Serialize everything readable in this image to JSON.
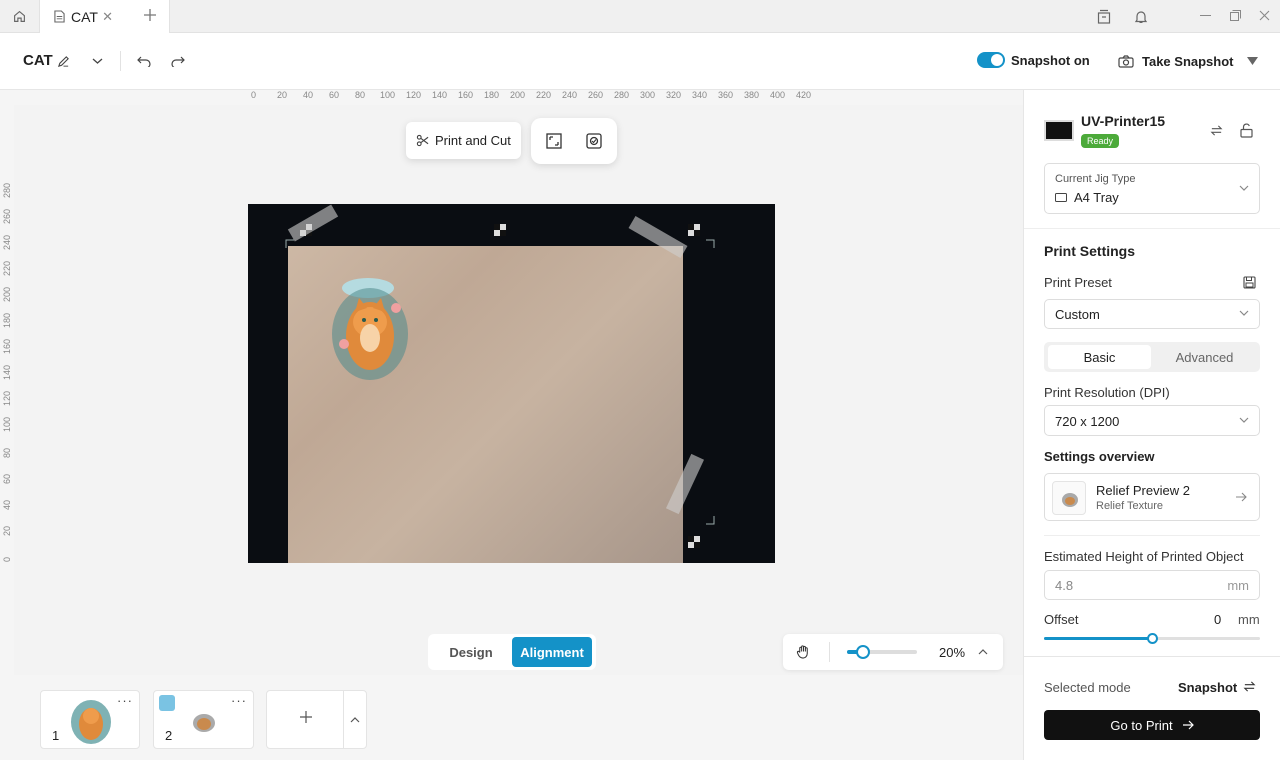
{
  "tabs": {
    "document_title": "CAT"
  },
  "toolbar": {
    "project_title": "CAT",
    "snapshot_label": "Snapshot on",
    "snapshot_enabled": true,
    "take_snapshot_label": "Take Snapshot"
  },
  "rulers": {
    "horizontal": [
      "0",
      "20",
      "40",
      "60",
      "80",
      "100",
      "120",
      "140",
      "160",
      "180",
      "200",
      "220",
      "240",
      "260",
      "280",
      "300",
      "320",
      "340",
      "360",
      "380",
      "400",
      "420"
    ],
    "vertical": [
      "280",
      "260",
      "240",
      "220",
      "200",
      "180",
      "160",
      "140",
      "120",
      "100",
      "80",
      "60",
      "40",
      "20",
      "0"
    ]
  },
  "canvas": {
    "print_and_cut_label": "Print and Cut",
    "design_label": "Design",
    "alignment_label": "Alignment",
    "active_mode": "Alignment",
    "zoom_value": "20%"
  },
  "thumbnails": [
    {
      "number": "1",
      "more": "···"
    },
    {
      "number": "2",
      "more": "···"
    }
  ],
  "panel": {
    "printer_name": "UV-Printer15",
    "printer_status": "Ready",
    "jig_label": "Current Jig Type",
    "jig_value": "A4 Tray",
    "print_settings_title": "Print Settings",
    "preset_label": "Print Preset",
    "preset_value": "Custom",
    "tab_basic": "Basic",
    "tab_advanced": "Advanced",
    "resolution_label": "Print Resolution (DPI)",
    "resolution_value": "720 x 1200",
    "overview_label": "Settings overview",
    "overview_title": "Relief Preview 2",
    "overview_subtitle": "Relief Texture",
    "height_label": "Estimated Height of Printed Object",
    "height_value": "4.8",
    "height_unit": "mm",
    "offset_label": "Offset",
    "offset_value": "0",
    "offset_unit": "mm",
    "offset_level_percent": 50,
    "selected_mode_label": "Selected mode",
    "selected_mode_value": "Snapshot",
    "go_print_label": "Go to Print"
  },
  "colors": {
    "accent": "#1492c8",
    "ready": "#4caa3a"
  }
}
